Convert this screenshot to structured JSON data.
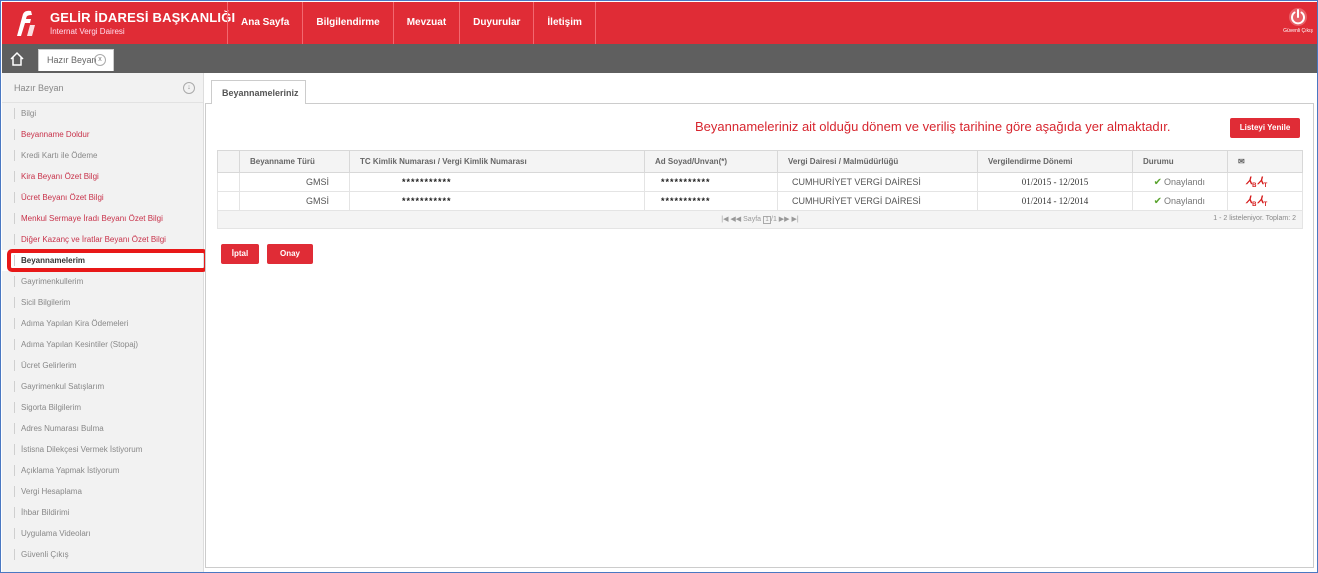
{
  "header": {
    "title": "GELİR İDARESİ BAŞKANLIĞI",
    "subtitle": "İnternat Vergi Dairesi",
    "nav": [
      "Ana Sayfa",
      "Bilgilendirme",
      "Mevzuat",
      "Duyurular",
      "İletişim"
    ],
    "logout_label": "Güvenli Çıkış",
    "accent": "#e02c36"
  },
  "tabs": {
    "open_tab": "Hazır Beyan",
    "close_symbol": "x"
  },
  "sidebar": {
    "title": "Hazır Beyan",
    "collapse_symbol": "↓",
    "items": [
      {
        "label": "Bilgi",
        "style": "muted"
      },
      {
        "label": "Beyanname Doldur",
        "style": "red"
      },
      {
        "label": "Kredi Kartı ile Ödeme",
        "style": "muted"
      },
      {
        "label": "Kira Beyanı Özet Bilgi",
        "style": "red"
      },
      {
        "label": "Ücret Beyanı Özet Bilgi",
        "style": "red"
      },
      {
        "label": "Menkul Sermaye İradı Beyanı Özet Bilgi",
        "style": "red"
      },
      {
        "label": "Diğer Kazanç ve İratlar Beyanı Özet Bilgi",
        "style": "red"
      },
      {
        "label": "Beyannamelerim",
        "style": "active"
      },
      {
        "label": "Gayrimenkullerim",
        "style": "muted"
      },
      {
        "label": "Sicil Bilgilerim",
        "style": "muted"
      },
      {
        "label": "Adıma Yapılan Kira Ödemeleri",
        "style": "muted"
      },
      {
        "label": "Adıma Yapılan Kesintiler (Stopaj)",
        "style": "muted"
      },
      {
        "label": "Ücret Gelirlerim",
        "style": "muted"
      },
      {
        "label": "Gayrimenkul Satışlarım",
        "style": "muted"
      },
      {
        "label": "Sigorta Bilgilerim",
        "style": "muted"
      },
      {
        "label": "Adres Numarası Bulma",
        "style": "muted"
      },
      {
        "label": "İstisna Dilekçesi Vermek İstiyorum",
        "style": "muted"
      },
      {
        "label": "Açıklama Yapmak İstiyorum",
        "style": "muted"
      },
      {
        "label": "Vergi Hesaplama",
        "style": "muted"
      },
      {
        "label": "İhbar Bildirimi",
        "style": "muted"
      },
      {
        "label": "Uygulama Videoları",
        "style": "muted"
      },
      {
        "label": "Güvenli Çıkış",
        "style": "muted"
      }
    ]
  },
  "main": {
    "tab_label": "Beyannameleriniz",
    "notice": "Beyannameleriniz ait olduğu dönem ve veriliş tarihine göre aşağıda yer almaktadır.",
    "refresh_label": "Listeyi Yenile",
    "cancel_label": "İptal",
    "approve_label": "Onay"
  },
  "table": {
    "headers": [
      "Beyanname Türü",
      "TC Kimlik Numarası / Vergi Kimlik Numarası",
      "Ad Soyad/Unvan(*)",
      "Vergi Dairesi / Malmüdürlüğü",
      "Vergilendirme Dönemi",
      "Durumu",
      "✉"
    ],
    "rows": [
      {
        "type": "GMSİ",
        "tc": "***********",
        "name": "***********",
        "office": "CUMHURİYET VERGİ DAİRESİ",
        "period": "01/2015 - 12/2015",
        "status": "Onaylandı"
      },
      {
        "type": "GMSİ",
        "tc": "***********",
        "name": "***********",
        "office": "CUMHURİYET VERGİ DAİRESİ",
        "period": "01/2014 - 12/2014",
        "status": "Onaylandı"
      }
    ],
    "pager": {
      "nav_prev": "|◀ ◀◀",
      "page_label": "Sayfa",
      "page": "1",
      "total": "/1",
      "nav_next": "▶▶ ▶|",
      "summary": "1 - 2 listeleniyor. Toplam: 2"
    },
    "doc_icon_letters": [
      "B",
      "T"
    ]
  }
}
